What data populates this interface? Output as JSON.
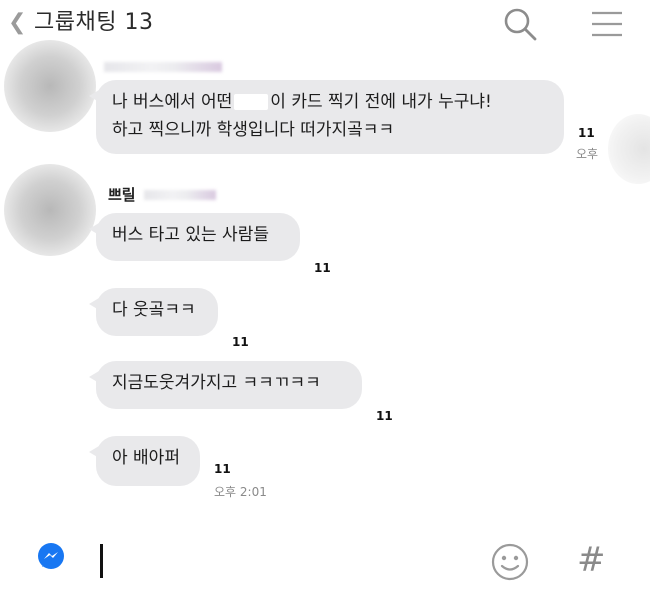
{
  "header": {
    "title": "그룹채팅 13",
    "icons": [
      "back-icon",
      "search-icon",
      "menu-icon"
    ]
  },
  "messages": [
    {
      "line1_before": "나 버스에서 어떤",
      "line1_after": "이 카드 찍기 전에 내가 누구냐!",
      "line2": "하고 찍으니까 학생입니다 떠가지곸ㅋㅋ",
      "unread": "11",
      "time": "오후"
    }
  ],
  "sender2": {
    "name": "쁘릴",
    "messages": [
      {
        "text": "버스 타고 있는 사람들",
        "unread": "11"
      },
      {
        "text": "다 웃곸ㅋㅋ",
        "unread": "11"
      },
      {
        "text": "지금도웃겨가지고 ㅋㅋㄲㅋㅋ",
        "unread": "11"
      },
      {
        "text": "아 배아퍼",
        "unread": "11",
        "time": "오후 2:01"
      }
    ]
  },
  "input": {
    "icons": [
      "messenger-icon",
      "emoji-icon",
      "hashtag-icon"
    ],
    "hash_glyph": "#"
  },
  "colors": {
    "bubble": "#e9e9eb",
    "messenger_blue": "#1877f2"
  }
}
